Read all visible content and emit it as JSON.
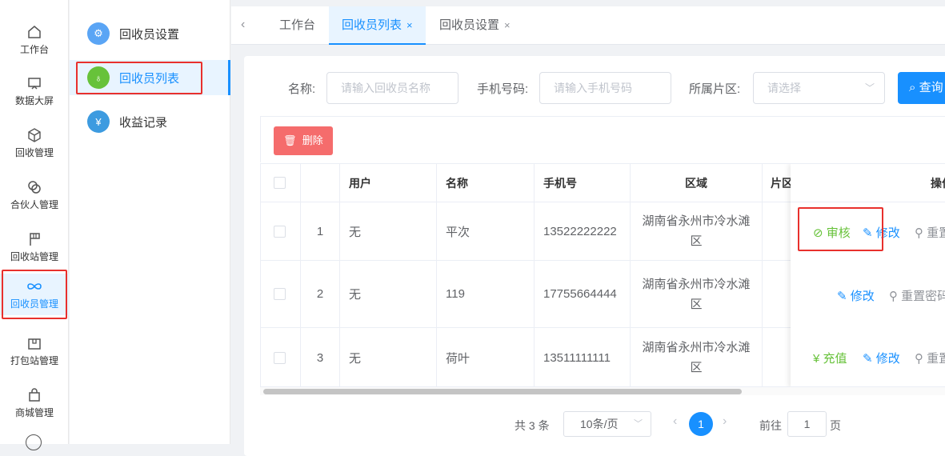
{
  "rail": {
    "items": [
      {
        "label": "工作台",
        "icon": "home-icon"
      },
      {
        "label": "数据大屏",
        "icon": "screen-icon"
      },
      {
        "label": "回收管理",
        "icon": "box-icon"
      },
      {
        "label": "合伙人管理",
        "icon": "link-icon"
      },
      {
        "label": "回收站管理",
        "icon": "flag-icon"
      },
      {
        "label": "回收员管理",
        "icon": "infinity-icon"
      },
      {
        "label": "打包站管理",
        "icon": "package-icon"
      },
      {
        "label": "商城管理",
        "icon": "bag-icon"
      }
    ]
  },
  "submenu": {
    "items": [
      {
        "label": "回收员设置",
        "icon": "settings-icon",
        "color": "#5aa5f5"
      },
      {
        "label": "回收员列表",
        "icon": "user-icon",
        "color": "#67c23a"
      },
      {
        "label": "收益记录",
        "icon": "yuan-icon",
        "color": "#3d9be0"
      }
    ]
  },
  "tabs": [
    {
      "label": "工作台"
    },
    {
      "label": "回收员列表",
      "close": "×"
    },
    {
      "label": "回收员设置",
      "close": "×"
    }
  ],
  "filters": {
    "name_label": "名称:",
    "name_placeholder": "请输入回收员名称",
    "phone_label": "手机号码:",
    "phone_placeholder": "请输入手机号码",
    "area_label": "所属片区:",
    "area_placeholder": "请选择",
    "search_label": "查询"
  },
  "toolbar": {
    "delete_label": "删除"
  },
  "table": {
    "headers": {
      "user": "用户",
      "name": "名称",
      "phone": "手机号",
      "region": "区域",
      "district": "片区",
      "ops": "操作"
    },
    "rows": [
      {
        "index": "1",
        "user": "无",
        "name": "平次",
        "phone": "13522222222",
        "region_line1": "湖南省永州市冷水滩",
        "region_line2": "区",
        "ops": [
          {
            "label": "审核",
            "type": "green",
            "glyph": "⊘"
          },
          {
            "label": "修改",
            "type": "blue",
            "glyph": "✎"
          },
          {
            "label": "重置密码",
            "type": "gray",
            "glyph": "⚲"
          }
        ]
      },
      {
        "index": "2",
        "user": "无",
        "name": "119",
        "phone": "17755664444",
        "region_line1": "湖南省永州市冷水滩",
        "region_line2": "区",
        "ops": [
          {
            "label": "修改",
            "type": "blue",
            "glyph": "✎"
          },
          {
            "label": "重置密码",
            "type": "gray",
            "glyph": "⚲"
          }
        ]
      },
      {
        "index": "3",
        "user": "无",
        "name": "荷叶",
        "phone": "13511111111",
        "region_line1": "湖南省永州市冷水滩",
        "region_line2": "区",
        "ops": [
          {
            "label": "充值",
            "type": "green",
            "glyph": "¥"
          },
          {
            "label": "修改",
            "type": "blue",
            "glyph": "✎"
          },
          {
            "label": "重置密码",
            "type": "gray",
            "glyph": "⚲"
          }
        ]
      }
    ]
  },
  "pagination": {
    "total_text": "共 3 条",
    "page_size": "10条/页",
    "current_page": "1",
    "goto_label": "前往",
    "goto_value": "1",
    "page_suffix": "页"
  }
}
